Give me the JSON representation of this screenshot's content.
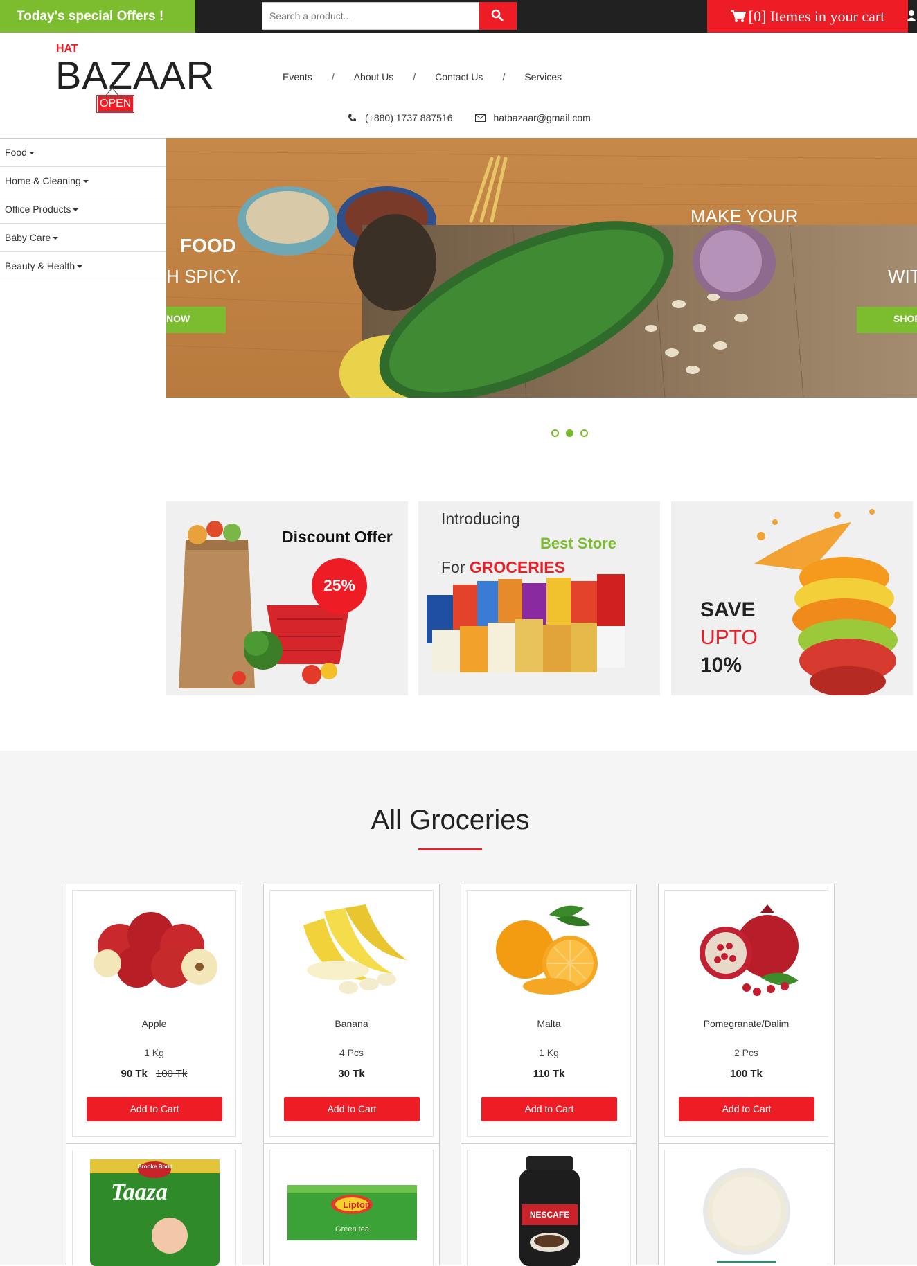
{
  "topbar": {
    "offers_label": "Today's special Offers !",
    "search_placeholder": "Search a product...",
    "cart_label": "[0] Itemes in your cart"
  },
  "header": {
    "logo_small": "HAT",
    "logo_main": "BAZAAR",
    "logo_sign": "OPEN",
    "nav": [
      "Events",
      "About Us",
      "Contact Us",
      "Services"
    ],
    "nav_separator": "/",
    "phone": "(+880) 1737 887516",
    "email": "hatbazaar@gmail.com"
  },
  "sidebar": {
    "items": [
      "Food",
      "Home & Cleaning",
      "Office Products",
      "Baby Care",
      "Beauty & Health"
    ]
  },
  "slider": {
    "left_heading": "FOOD",
    "left_sub": "H SPICY.",
    "left_button": "NOW",
    "right_heading": "MAKE YOUR",
    "right_sub": "WIT",
    "right_button": "SHOP",
    "active_dot": 2
  },
  "promos": {
    "discount_title": "Discount Offer",
    "discount_value": "25%",
    "intro_line1": "Introducing",
    "intro_line2": "Best Store",
    "intro_line3_prefix": "For",
    "intro_line3_highlight": "GROCERIES",
    "save_line1": "SAVE",
    "save_line2": "UPTO",
    "save_line3": "10%"
  },
  "groceries": {
    "title": "All Groceries",
    "products": [
      {
        "name": "Apple",
        "unit": "1 Kg",
        "price": "90 Tk",
        "old_price": "100 Tk",
        "button": "Add to Cart"
      },
      {
        "name": "Banana",
        "unit": "4 Pcs",
        "price": "30 Tk",
        "old_price": "",
        "button": "Add to Cart"
      },
      {
        "name": "Malta",
        "unit": "1 Kg",
        "price": "110 Tk",
        "old_price": "",
        "button": "Add to Cart"
      },
      {
        "name": "Pomegranate/Dalim",
        "unit": "2 Pcs",
        "price": "100 Tk",
        "old_price": "",
        "button": "Add to Cart"
      }
    ],
    "second_row": {
      "taaza_brand": "Taaza",
      "taaza_maker": "Brooke Bond",
      "lipton_brand": "Lipton",
      "lipton_sub": "Green tea",
      "nescafe_brand": "NESCAFE"
    }
  },
  "colors": {
    "accent_red": "#ee1c25",
    "accent_green": "#7cbd2f",
    "dark_bar": "#212121"
  }
}
